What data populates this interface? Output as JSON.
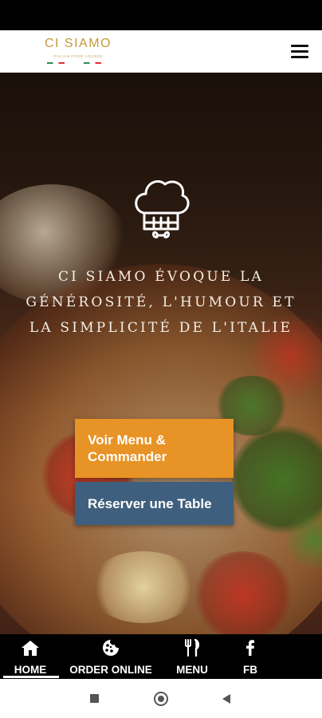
{
  "header": {
    "logo_title": "CI SIAMO",
    "logo_subtitle": "ITALIAN FOOD LOUNGE",
    "menu_icon": "hamburger-icon"
  },
  "hero": {
    "icon": "chef-hat-icon",
    "tagline": "Ci Siamo évoque la générosité, l'humour et la simplicité de l'Italie",
    "buttons": {
      "order_label": "Voir Menu & Commander",
      "reserve_label": "Réserver une Table"
    },
    "colors": {
      "order_button": "#e89325",
      "reserve_button": "#3f5f7e"
    }
  },
  "bottom_nav": {
    "items": [
      {
        "label": "HOME",
        "icon": "home-icon",
        "active": true
      },
      {
        "label": "ORDER ONLINE",
        "icon": "cookie-icon"
      },
      {
        "label": "MENU",
        "icon": "utensils-icon"
      },
      {
        "label": "FB",
        "icon": "facebook-icon"
      }
    ]
  },
  "system_nav": {
    "icons": [
      "recent-apps-icon",
      "home-circle-icon",
      "back-icon"
    ]
  }
}
